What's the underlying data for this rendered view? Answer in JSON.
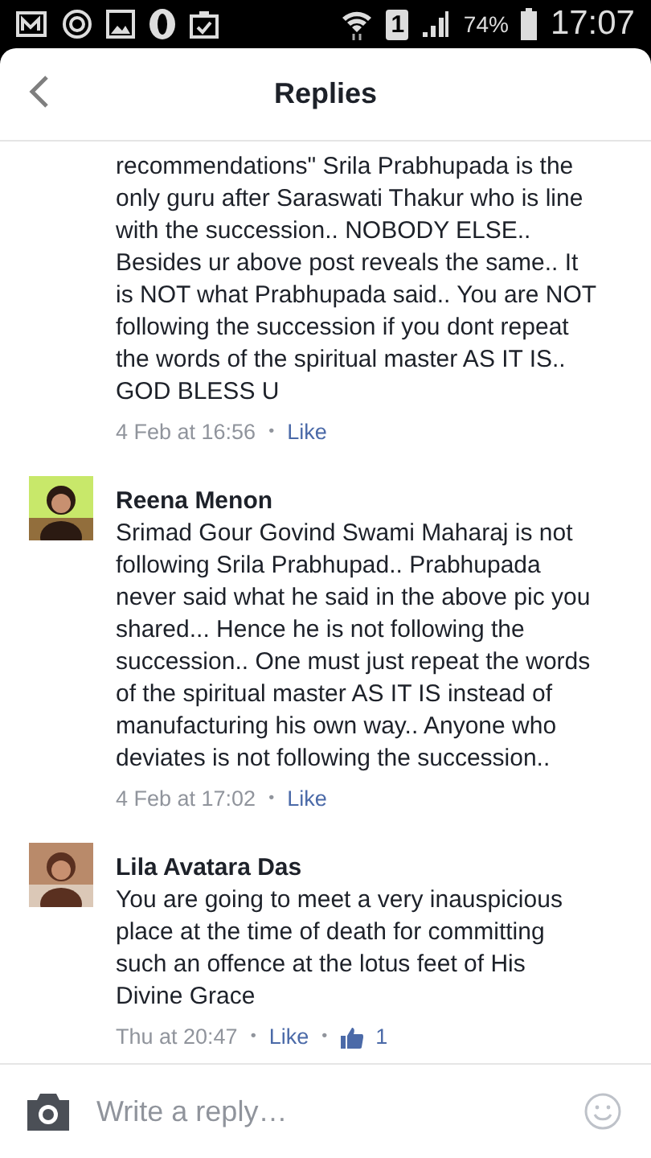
{
  "status_bar": {
    "sim": "1",
    "battery": "74%",
    "time": "17:07"
  },
  "header": {
    "title": "Replies"
  },
  "comments": [
    {
      "text": "recommendations\" Srila Prabhupada is the only guru after Saraswati Thakur who is line with the succession.. NOBODY ELSE.. Besides ur above post reveals the same.. It is NOT what Prabhupada said.. You are NOT following the succession if you dont repeat the words of the spiritual master AS IT IS.. GOD BLESS U",
      "time": "4 Feb at 16:56",
      "separator": "•",
      "like": "Like"
    },
    {
      "author": "Reena Menon",
      "text": "Srimad Gour Govind Swami Maharaj is not following Srila Prabhupad.. Prabhupada never said what he said in the above pic you shared... Hence he is not following the succession.. One must just repeat the words of the spiritual master AS IT IS instead of manufacturing his own way.. Anyone who deviates is not following the succession..",
      "time": "4 Feb at 17:02",
      "separator": "•",
      "like": "Like"
    },
    {
      "author": "Lila Avatara Das",
      "text": "You are going to meet a very inauspicious place at the time of death for committing such an offence at the lotus feet of His Divine Grace",
      "time": "Thu at 20:47",
      "separator": "•",
      "like": "Like",
      "like_separator": "•",
      "like_count": "1"
    }
  ],
  "composer": {
    "placeholder": "Write a reply…"
  }
}
